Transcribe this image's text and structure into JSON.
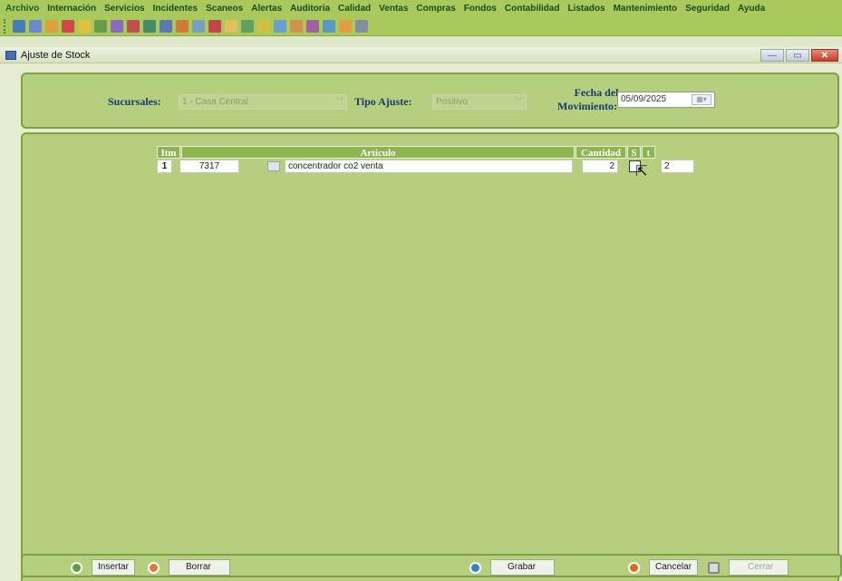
{
  "menu": [
    "Archivo",
    "Internación",
    "Servicios",
    "Incidentes",
    "Scaneos",
    "Alertas",
    "Auditoria",
    "Calidad",
    "Ventas",
    "Compras",
    "Fondos",
    "Contabilidad",
    "Listados",
    "Mantenimiento",
    "Seguridad",
    "Ayuda"
  ],
  "toolbar_icons": [
    "#4a7ab8",
    "#6a8ac8",
    "#e0a040",
    "#d04848",
    "#e0c040",
    "#6a9a4a",
    "#8a6ac0",
    "#c05050",
    "#4a8a6a",
    "#5a7ab0",
    "#d07a40",
    "#7aa0c0",
    "#c04848",
    "#e0c060",
    "#60a060",
    "#d0c040",
    "#6aa0d0",
    "#d09050",
    "#a060a0",
    "#5a9ac0",
    "#e0a040",
    "#8090a0"
  ],
  "window": {
    "title": "Ajuste de Stock",
    "minimize": "—",
    "restore": "▭",
    "close": "✕"
  },
  "filters": {
    "sucursales_label": "Sucursales:",
    "sucursales_value": "1 - Casa Central",
    "tipo_label": "Tipo Ajuste:",
    "tipo_value": "Positivo",
    "fecha_label_1": "Fecha del",
    "fecha_label_2": "Movimiento:",
    "fecha_value": "05/09/2025"
  },
  "grid": {
    "headers": {
      "item": "Itm",
      "articulo": "Articulo",
      "cantidad": "Cantidad",
      "s": "S",
      "t": "t"
    },
    "rows": [
      {
        "item": "1",
        "code": "7317",
        "desc": "concentrador co2 venta",
        "cantidad": "2",
        "s_checked": false,
        "t": "2"
      }
    ]
  },
  "buttons": {
    "insertar": "Insertar",
    "borrar": "Borrar",
    "grabar": "Grabar",
    "cancelar": "Cancelar",
    "cerrar": "Cerrar"
  },
  "colors": {
    "accent_green": "#8db551",
    "panel_green": "#b5cf7f",
    "label_blue": "#1a3a6a"
  }
}
